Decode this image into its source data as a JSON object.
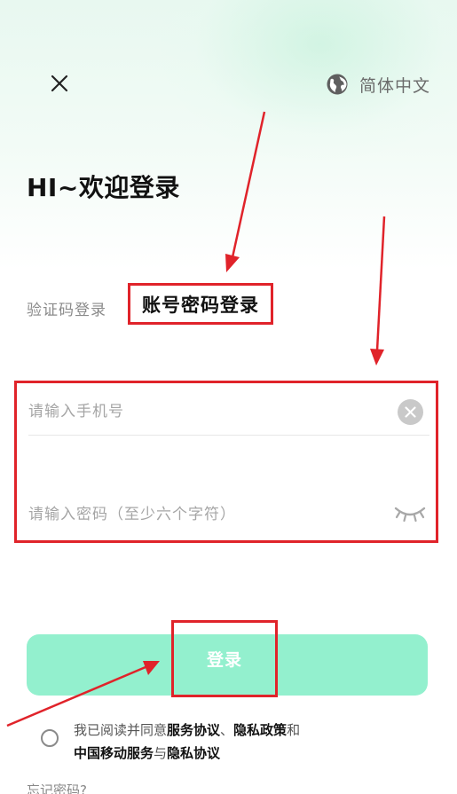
{
  "top_bar": {
    "close_icon": "close-icon",
    "language_icon": "globe-icon",
    "language_label": "简体中文"
  },
  "heading": {
    "welcome": "HI~欢迎登录"
  },
  "tabs": [
    {
      "label": "验证码登录",
      "active": false
    },
    {
      "label": "账号密码登录",
      "active": true
    }
  ],
  "form": {
    "phone_placeholder": "请输入手机号",
    "phone_value": "",
    "password_placeholder": "请输入密码（至少六个字符）",
    "password_value": "",
    "clear_icon": "clear-icon",
    "visibility_icon": "eye-closed-icon"
  },
  "login": {
    "label": "登录"
  },
  "agreement": {
    "prefix": "我已阅读并同意",
    "service_agreement": "服务协议",
    "separator1": "、",
    "privacy_policy": "隐私政策",
    "conjunction1": "和",
    "cmcc_service": "中国移动服务",
    "conjunction2": "与",
    "privacy_agreement": "隐私协议",
    "checked": false
  },
  "forgot_password": "忘记密码?",
  "colors": {
    "accent": "#93f0ce",
    "annotation_red": "#e0232a",
    "text_primary": "#111111",
    "text_muted": "#8a8a8a"
  }
}
